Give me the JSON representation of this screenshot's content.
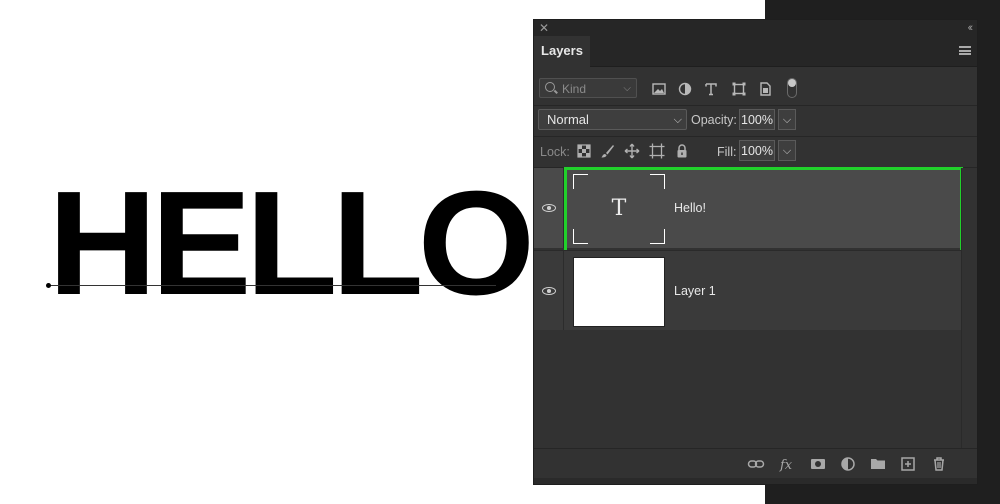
{
  "canvas": {
    "text": "HELLO!"
  },
  "panel": {
    "close_glyph": "✕",
    "collapse_glyph": "‹‹",
    "tab_label": "Layers",
    "filter": {
      "kind_label": "Kind",
      "chevron": "⌵",
      "icons": [
        "image-filter-icon",
        "adjustment-filter-icon",
        "type-filter-icon",
        "shape-filter-icon",
        "smart-object-filter-icon"
      ]
    },
    "blend_mode": "Normal",
    "opacity_label": "Opacity:",
    "opacity_value": "100%",
    "lock_label": "Lock:",
    "fill_label": "Fill:",
    "fill_value": "100%",
    "layers": [
      {
        "name": "Hello!",
        "type": "text",
        "thumb_glyph": "T",
        "selected": true
      },
      {
        "name": "Layer 1",
        "type": "pixel",
        "selected": false
      }
    ],
    "footer_icons": [
      "link-layers-icon",
      "fx-icon",
      "layer-mask-icon",
      "adjustment-layer-icon",
      "group-folder-icon",
      "new-layer-icon",
      "trash-icon"
    ]
  },
  "colors": {
    "selection_outline": "#21d12b",
    "panel_bg": "#323232",
    "selected_row": "#4a4a4a"
  }
}
